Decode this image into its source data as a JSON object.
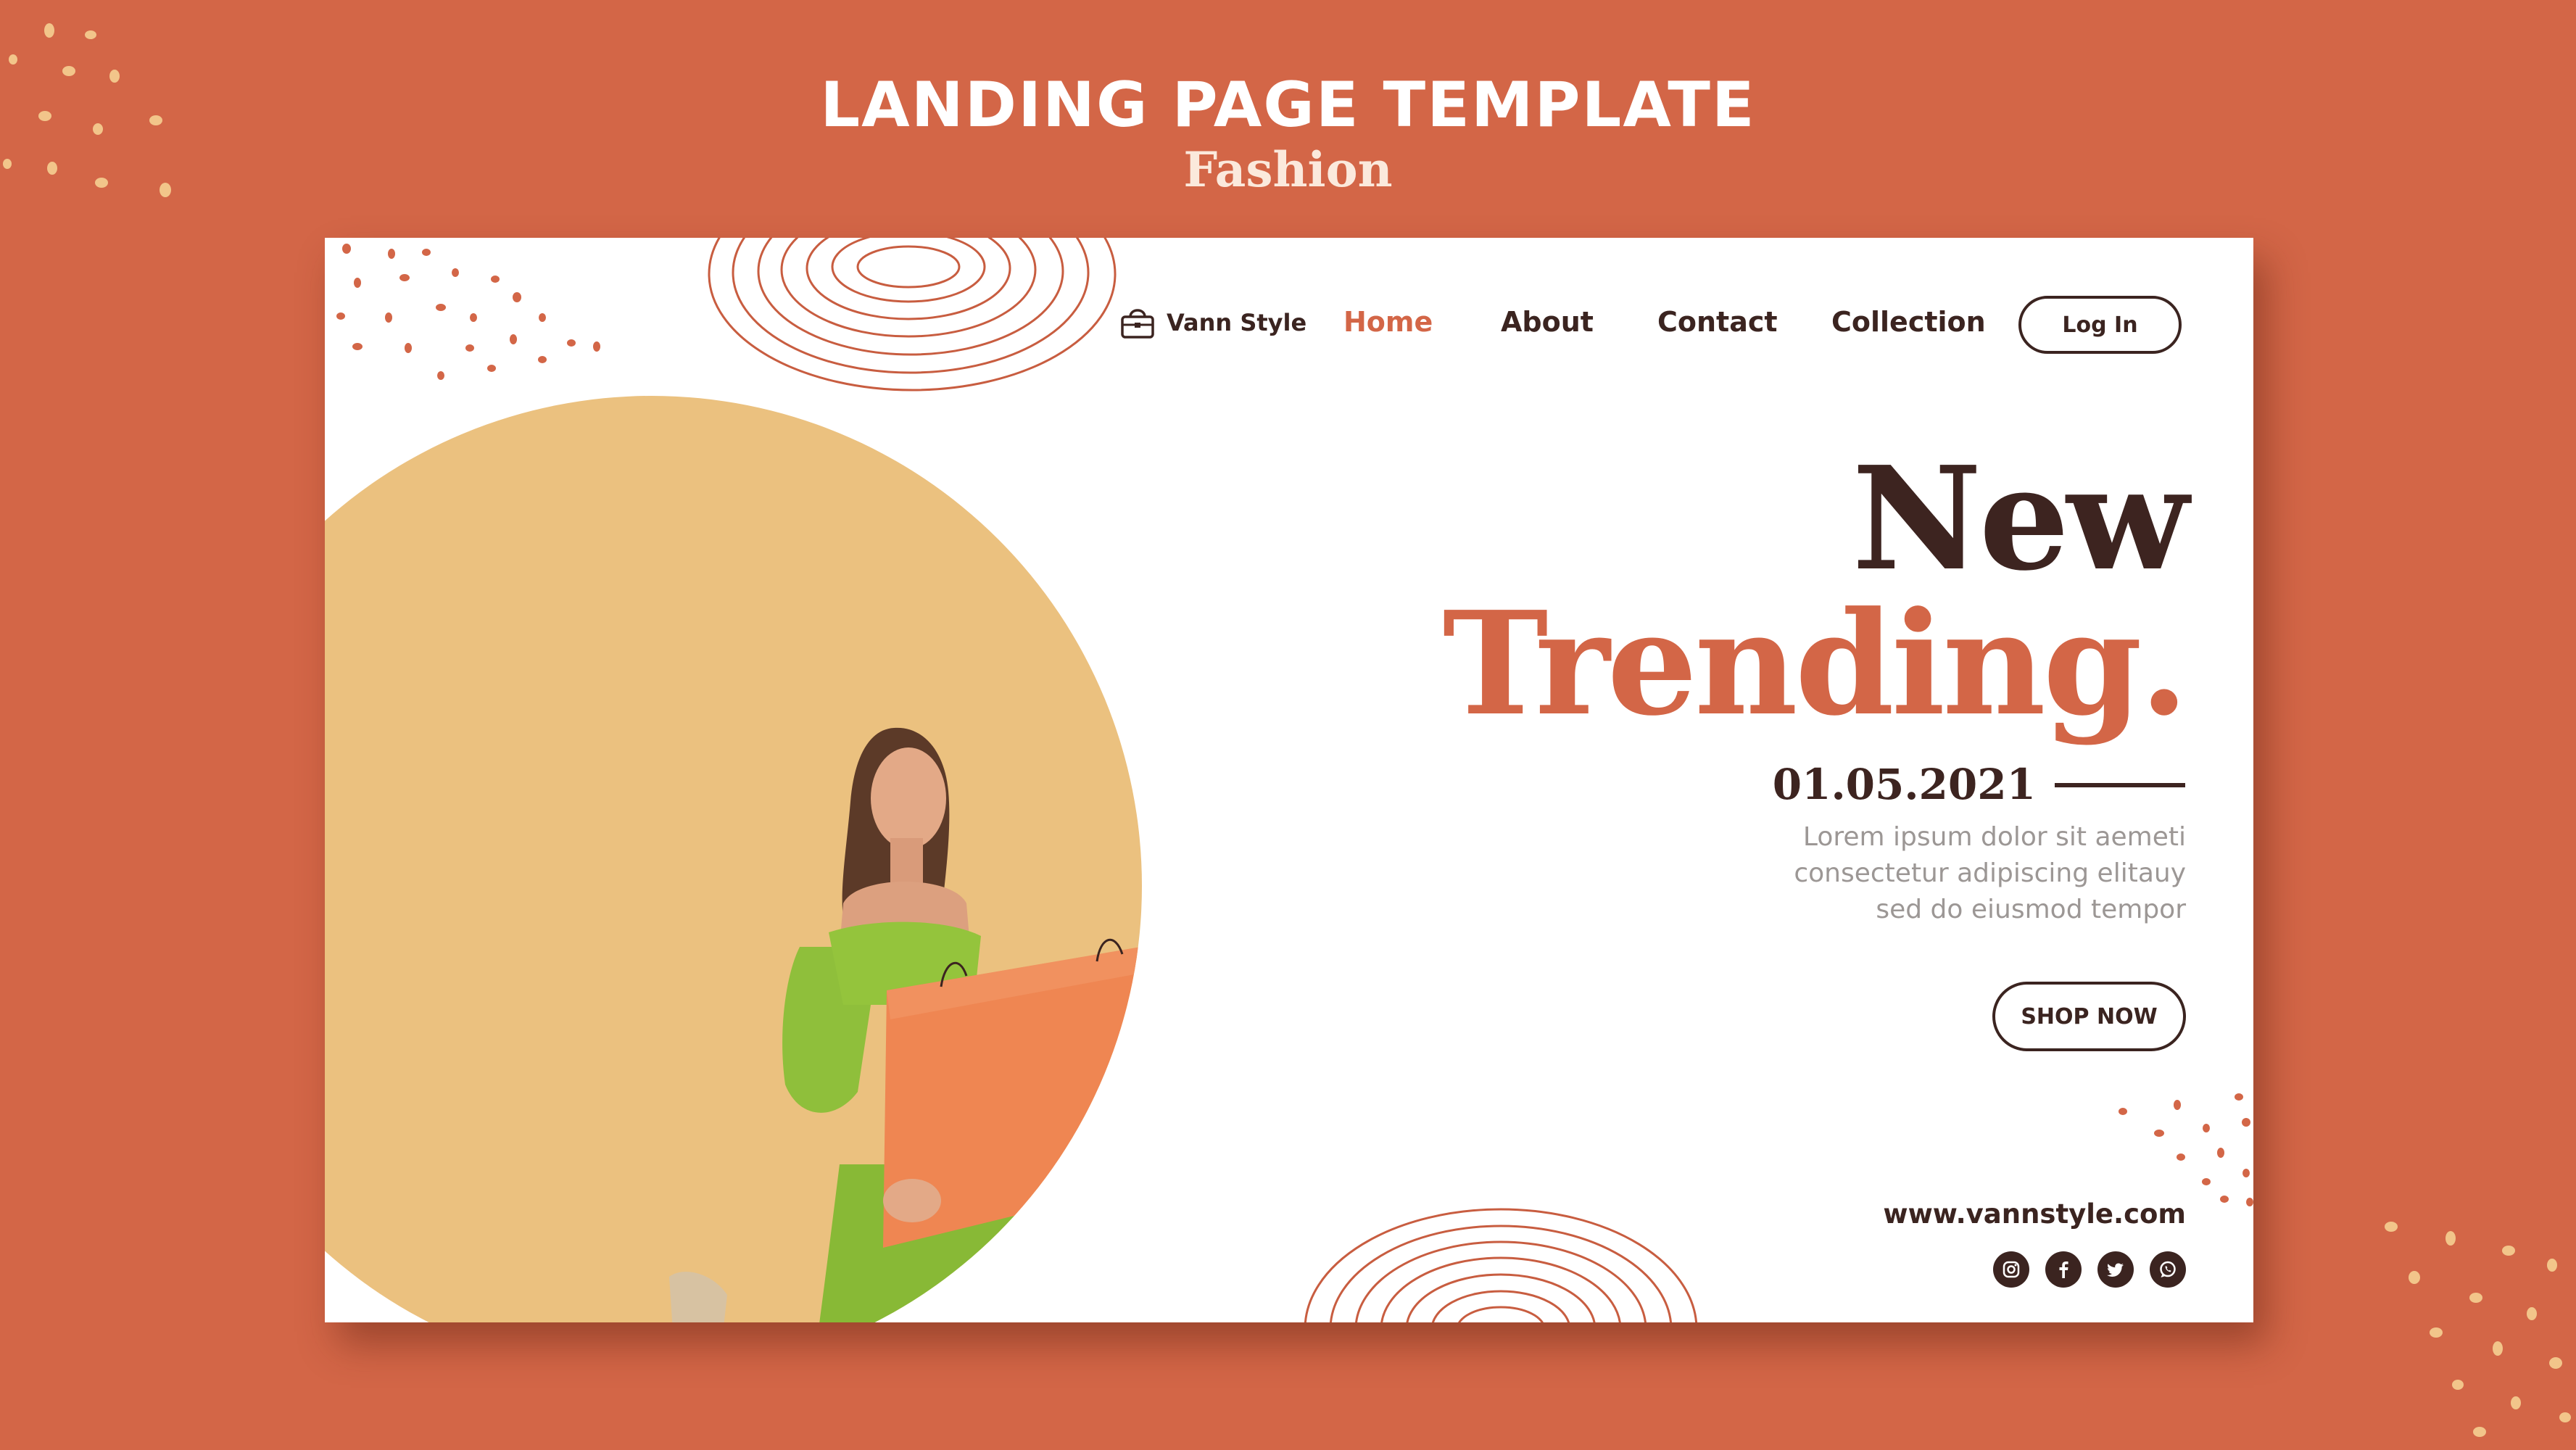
{
  "template": {
    "title": "LANDING PAGE TEMPLATE",
    "subtitle": "Fashion"
  },
  "brand": {
    "name": "Vann Style",
    "icon": "handbag-icon"
  },
  "nav": {
    "items": [
      {
        "label": "Home",
        "active": true
      },
      {
        "label": "About",
        "active": false
      },
      {
        "label": "Contact",
        "active": false
      },
      {
        "label": "Collection",
        "active": false
      }
    ],
    "login_label": "Log In"
  },
  "hero": {
    "headline_1": "New",
    "headline_2": "Trending.",
    "date": "01.05.2021",
    "body_lines": [
      "Lorem ipsum dolor sit aemeti",
      "consectetur adipiscing elitauy",
      "sed do eiusmod tempor"
    ],
    "cta_label": "SHOP NOW"
  },
  "footer": {
    "website": "www.vannstyle.com",
    "social_icons": [
      "instagram-icon",
      "facebook-icon",
      "twitter-icon",
      "whatsapp-icon"
    ]
  },
  "colors": {
    "background": "#d36647",
    "accent": "#d36647",
    "dark": "#3b2420",
    "circle": "#ebc17f",
    "dots": "#f2c58a"
  }
}
